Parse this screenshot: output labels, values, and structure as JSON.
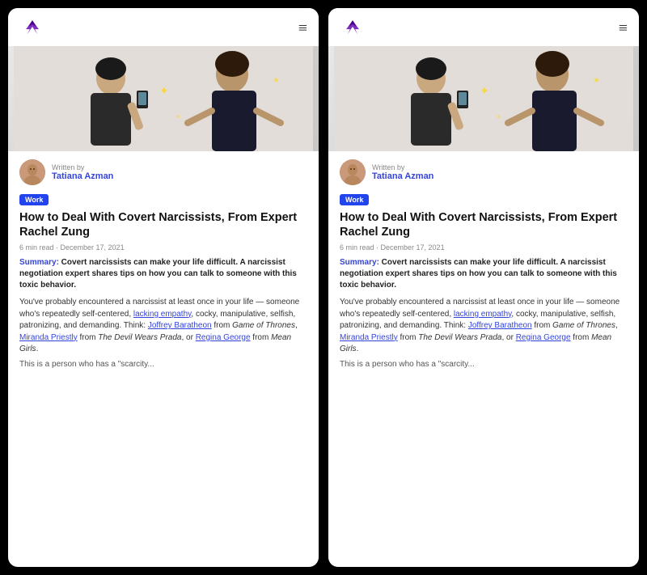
{
  "app": {
    "background_color": "#000000",
    "logo_alt": "Menshealth logo"
  },
  "panels": [
    {
      "id": "left",
      "header": {
        "logo_label": "MH",
        "hamburger_label": "≡"
      },
      "article": {
        "written_by_label": "Written by",
        "author_name": "Tatiana Azman",
        "category": "Work",
        "title": "How to Deal With Covert Narcissists, From Expert Rachel Zung",
        "meta": "6 min read · December 17, 2021",
        "summary_label": "Summary:",
        "summary_text": " Covert narcissists can make your life difficult. A narcissist negotiation expert shares tips on how you can talk to someone with this toxic behavior.",
        "body1": "You've probably encountered a narcissist at least once in your life — someone who's repeatedly self-centered, ",
        "link1": "lacking empathy",
        "body2": ", cocky, manipulative, selfish, patronizing, and demanding. Think: ",
        "link2": "Joffrey Baratheon",
        "body3": " from ",
        "italic1": "Game of Thrones",
        "body4": ", ",
        "link3": "Miranda Priestly",
        "body5": " from ",
        "italic2": "The Devil Wears Prada",
        "body6": ", or ",
        "link4": "Regina George",
        "body7": " from ",
        "italic3": "Mean Girls",
        "body8": ".",
        "truncated": "This is a person who has a \"scarcity..."
      }
    },
    {
      "id": "right",
      "header": {
        "logo_label": "MH",
        "hamburger_label": "≡"
      },
      "article": {
        "written_by_label": "Written by",
        "author_name": "Tatiana Azman",
        "category": "Work",
        "title": "How to Deal With Covert Narcissists, From Expert Rachel Zung",
        "meta": "6 min read · December 17, 2021",
        "summary_label": "Summary:",
        "summary_text": " Covert narcissists can make your life difficult. A narcissist negotiation expert shares tips on how you can talk to someone with this toxic behavior.",
        "body1": "You've probably encountered a narcissist at least once in your life — someone who's repeatedly self-centered, ",
        "link1": "lacking empathy",
        "body2": ", cocky, manipulative, selfish, patronizing, and demanding. Think: ",
        "link2": "Joffrey Baratheon",
        "body3": " from ",
        "italic1": "Game of Thrones",
        "body4": ", ",
        "link3": "Miranda Priestly",
        "body5": " from ",
        "italic2": "The Devil Wears Prada",
        "body6": ", or ",
        "link4": "Regina George",
        "body7": " from ",
        "italic3": "Mean Girls",
        "body8": ".",
        "truncated": "This is a person who has a \"scarcity..."
      }
    }
  ]
}
